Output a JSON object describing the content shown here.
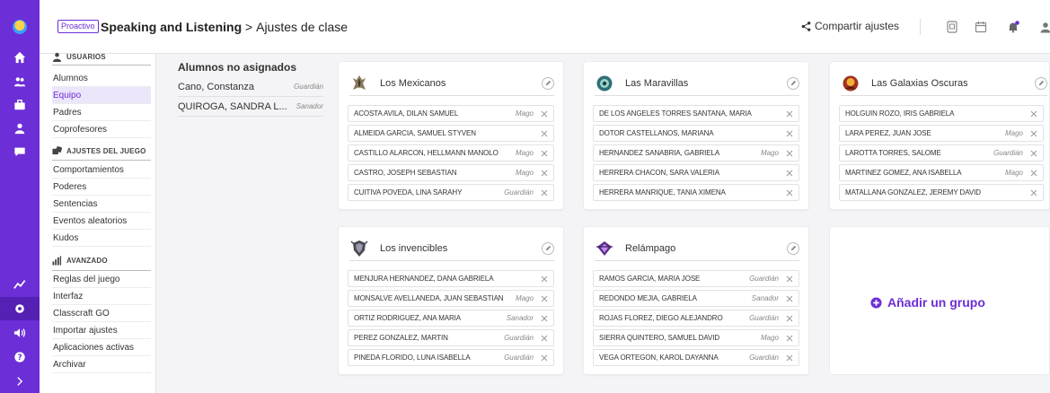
{
  "header": {
    "badge": "Proactivo",
    "course": "Speaking and Listening",
    "separator": ">",
    "page_title": "Ajustes de clase",
    "share_label": "Compartir ajustes"
  },
  "colors": {
    "accent": "#6c2ed6",
    "rail": "#6c2ed6"
  },
  "rail": {
    "icons": [
      "logo-icon",
      "home-icon",
      "users-icon",
      "shop-icon",
      "profile-icon",
      "chat-icon",
      "stats-icon",
      "settings-icon",
      "sound-icon",
      "help-icon",
      "expand-icon"
    ]
  },
  "sidebar": {
    "users_heading": "USUARIOS",
    "users_items": [
      "Alumnos",
      "Equipo",
      "Padres",
      "Coprofesores"
    ],
    "game_heading": "AJUSTES DEL JUEGO",
    "game_items": [
      "Comportamientos",
      "Poderes",
      "Sentencias",
      "Eventos aleatorios",
      "Kudos"
    ],
    "advanced_heading": "AVANZADO",
    "advanced_items": [
      "Reglas del juego",
      "Interfaz",
      "Classcraft GO",
      "Importar ajustes",
      "Aplicaciones activas",
      "Archivar"
    ]
  },
  "unassigned": {
    "title": "Alumnos no asignados",
    "students": [
      {
        "name": "Cano, Constanza",
        "role": "Guardián"
      },
      {
        "name": "QUIROGA, SANDRA L...",
        "role": "Sanador"
      }
    ]
  },
  "groups": [
    {
      "name": "Los Mexicanos",
      "members": [
        {
          "name": "ACOSTA AVILA, DILAN SAMUEL",
          "role": "Mago"
        },
        {
          "name": "ALMEIDA GARCIA, SAMUEL STYVEN",
          "role": ""
        },
        {
          "name": "CASTILLO ALARCON, HELLMANN MANOLO",
          "role": "Mago"
        },
        {
          "name": "CASTRO, JOSEPH SEBASTIAN",
          "role": "Mago"
        },
        {
          "name": "CUITIVA POVEDA, LINA SARAHY",
          "role": "Guardián"
        }
      ]
    },
    {
      "name": "Las Maravillas",
      "members": [
        {
          "name": "DE LOS ANGELES TORRES SANTANA, MARIA",
          "role": ""
        },
        {
          "name": "DOTOR CASTELLANOS, MARIANA",
          "role": ""
        },
        {
          "name": "HERNANDEZ SANABRIA, GABRIELA",
          "role": "Mago"
        },
        {
          "name": "HERRERA CHACON, SARA VALERIA",
          "role": ""
        },
        {
          "name": "HERRERA MANRIQUE, TANIA XIMENA",
          "role": ""
        }
      ]
    },
    {
      "name": "Las Galaxias Oscuras",
      "members": [
        {
          "name": "HOLGUIN ROZO, IRIS GABRIELA",
          "role": ""
        },
        {
          "name": "LARA PEREZ, JUAN JOSE",
          "role": "Mago"
        },
        {
          "name": "LAROTTA TORRES, SALOME",
          "role": "Guardián"
        },
        {
          "name": "MARTINEZ GOMEZ, ANA ISABELLA",
          "role": "Mago"
        },
        {
          "name": "MATALLANA GONZALEZ, JEREMY DAVID",
          "role": ""
        }
      ]
    },
    {
      "name": "Los invencibles",
      "members": [
        {
          "name": "MENJURA HERNANDEZ, DANA GABRIELA",
          "role": ""
        },
        {
          "name": "MONSALVE AVELLANEDA, JUAN SEBASTIAN",
          "role": "Mago"
        },
        {
          "name": "ORTIZ RODRIGUEZ, ANA MARIA",
          "role": "Sanador"
        },
        {
          "name": "PEREZ GONZALEZ, MARTIN",
          "role": "Guardián"
        },
        {
          "name": "PINEDA FLORIDO, LUNA ISABELLA",
          "role": "Guardián"
        }
      ]
    },
    {
      "name": "Relámpago",
      "members": [
        {
          "name": "RAMOS GARCIA, MARIA JOSE",
          "role": "Guardián"
        },
        {
          "name": "REDONDO MEJIA, GABRIELA",
          "role": "Sanador"
        },
        {
          "name": "ROJAS FLOREZ, DIEGO ALEJANDRO",
          "role": "Guardián"
        },
        {
          "name": "SIERRA QUINTERO, SAMUEL DAVID",
          "role": "Mago"
        },
        {
          "name": "VEGA ORTEGON, KAROL DAYANNA",
          "role": "Guardián"
        }
      ]
    }
  ],
  "add_group_label": "Añadir un grupo"
}
